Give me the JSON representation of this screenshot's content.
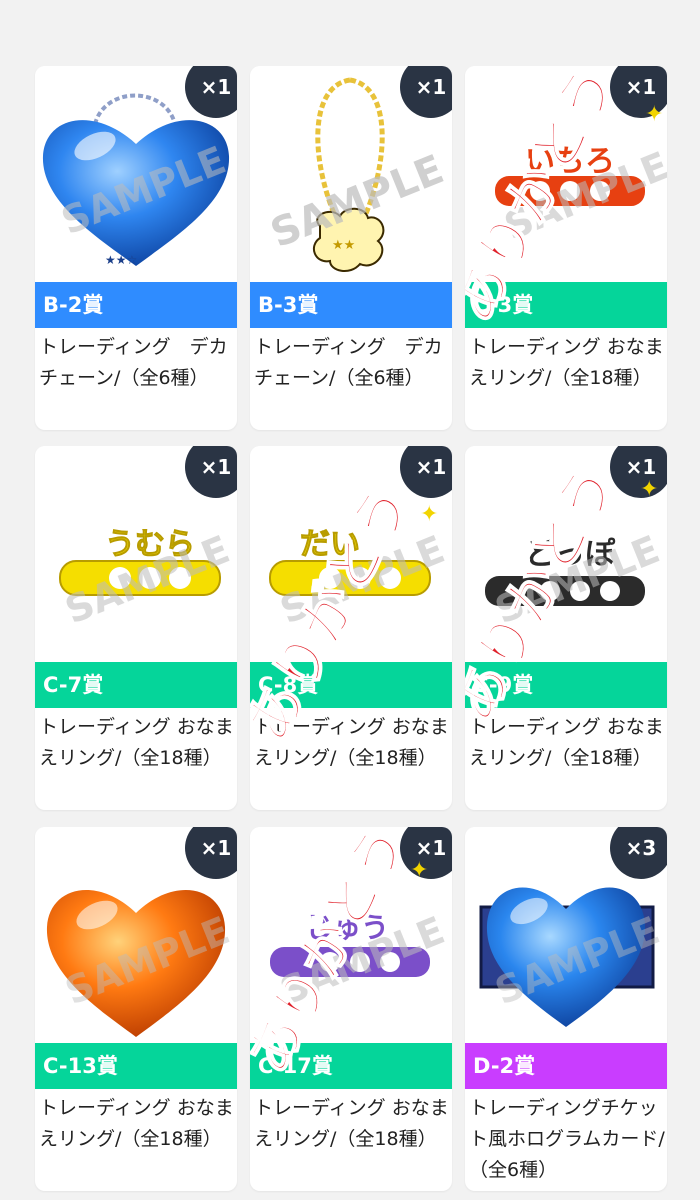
{
  "colors": {
    "badge_bg": "#2a3444",
    "label_blue": "#2f8cff",
    "label_green": "#05d59a",
    "label_purple": "#c93dff",
    "watermark": "#bdbdbd",
    "overlay_red": "#e0202a"
  },
  "watermark_text": "SAMPLE",
  "overlay_text": "ありがとう",
  "cards": [
    {
      "count": "×1",
      "label": "B-2賞",
      "label_color": "blue",
      "image": "blue-heart-chain-icon",
      "desc": "トレーディング　デカチェーン/（全6種）"
    },
    {
      "count": "×1",
      "label": "B-3賞",
      "label_color": "blue",
      "image": "gold-chain-charm-icon",
      "desc": "トレーディング　デカチェーン/（全6種）"
    },
    {
      "count": "×1",
      "label": "C-3賞",
      "label_color": "green",
      "image": "name-ring-icon",
      "desc": "トレーディング おなまえリング/（全18種）"
    },
    {
      "count": "×1",
      "label": "C-7賞",
      "label_color": "green",
      "image": "yellow-name-ring-icon",
      "desc": "トレーディング おなまえリング/（全18種）"
    },
    {
      "count": "×1",
      "label": "C-8賞",
      "label_color": "green",
      "image": "yellow-name-ring-icon",
      "desc": "トレーディング おなまえリング/（全18種）"
    },
    {
      "count": "×1",
      "label": "C-9賞",
      "label_color": "green",
      "image": "black-name-ring-icon",
      "desc": "トレーディング おなまえリング/（全18種）"
    },
    {
      "count": "×1",
      "label": "C-13賞",
      "label_color": "green",
      "image": "orange-heart-icon",
      "desc": "トレーディング おなまえリング/（全18種）"
    },
    {
      "count": "×1",
      "label": "C-17賞",
      "label_color": "green",
      "image": "purple-name-ring-icon",
      "desc": "トレーディング おなまえリング/（全18種）"
    },
    {
      "count": "×3",
      "label": "D-2賞",
      "label_color": "purple",
      "image": "blue-heart-card-icon",
      "desc": "トレーディングチケット風ホログラムカード/（全6種）"
    }
  ]
}
